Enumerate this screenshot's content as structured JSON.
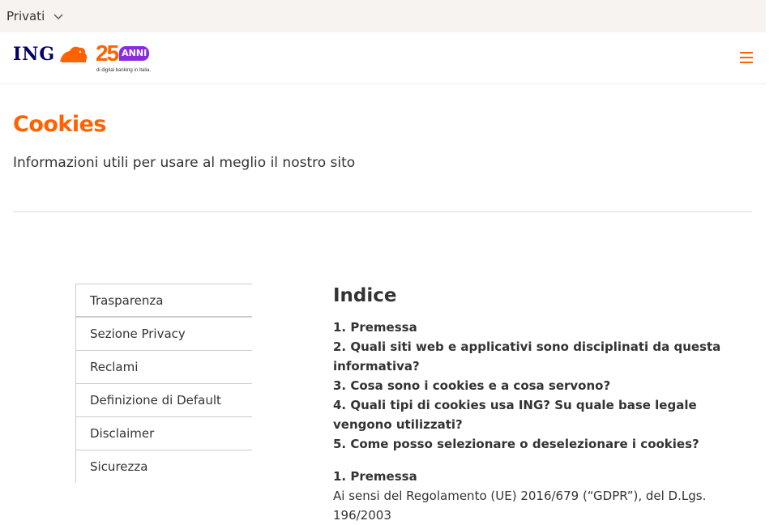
{
  "topbar": {
    "segment": "Privati"
  },
  "header": {
    "logo_text": "ING",
    "anniv_number": "25",
    "anniv_word": "ANNI",
    "anniv_sub": "di digital banking in Italia.",
    "menu_icon": "hamburger-icon"
  },
  "hero": {
    "title": "Cookies",
    "subtitle": "Informazioni utili per usare al meglio il nostro sito"
  },
  "sidenav": {
    "items": [
      "Trasparenza",
      "Sezione Privacy",
      "Reclami",
      "Definizione di Default",
      "Disclaimer",
      "Sicurezza"
    ]
  },
  "content": {
    "index_title": "Indice",
    "toc": [
      "1. Premessa",
      "2. Quali siti web e applicativi sono disciplinati da questa informativa?",
      "3. Cosa sono i cookies e a cosa servono?",
      "4. Quali tipi di cookies usa ING? Su quale base legale vengono utilizzati?",
      "5. Come posso selezionare o deselezionare i cookies?"
    ],
    "section1_title": "1. Premessa",
    "section1_text": "Ai sensi del Regolamento (UE) 2016/679 (“GDPR”), del D.Lgs. 196/2003"
  },
  "colors": {
    "accent": "#ff6200",
    "brand_blue": "#000066",
    "anniv_purple": "#8a2be2"
  }
}
